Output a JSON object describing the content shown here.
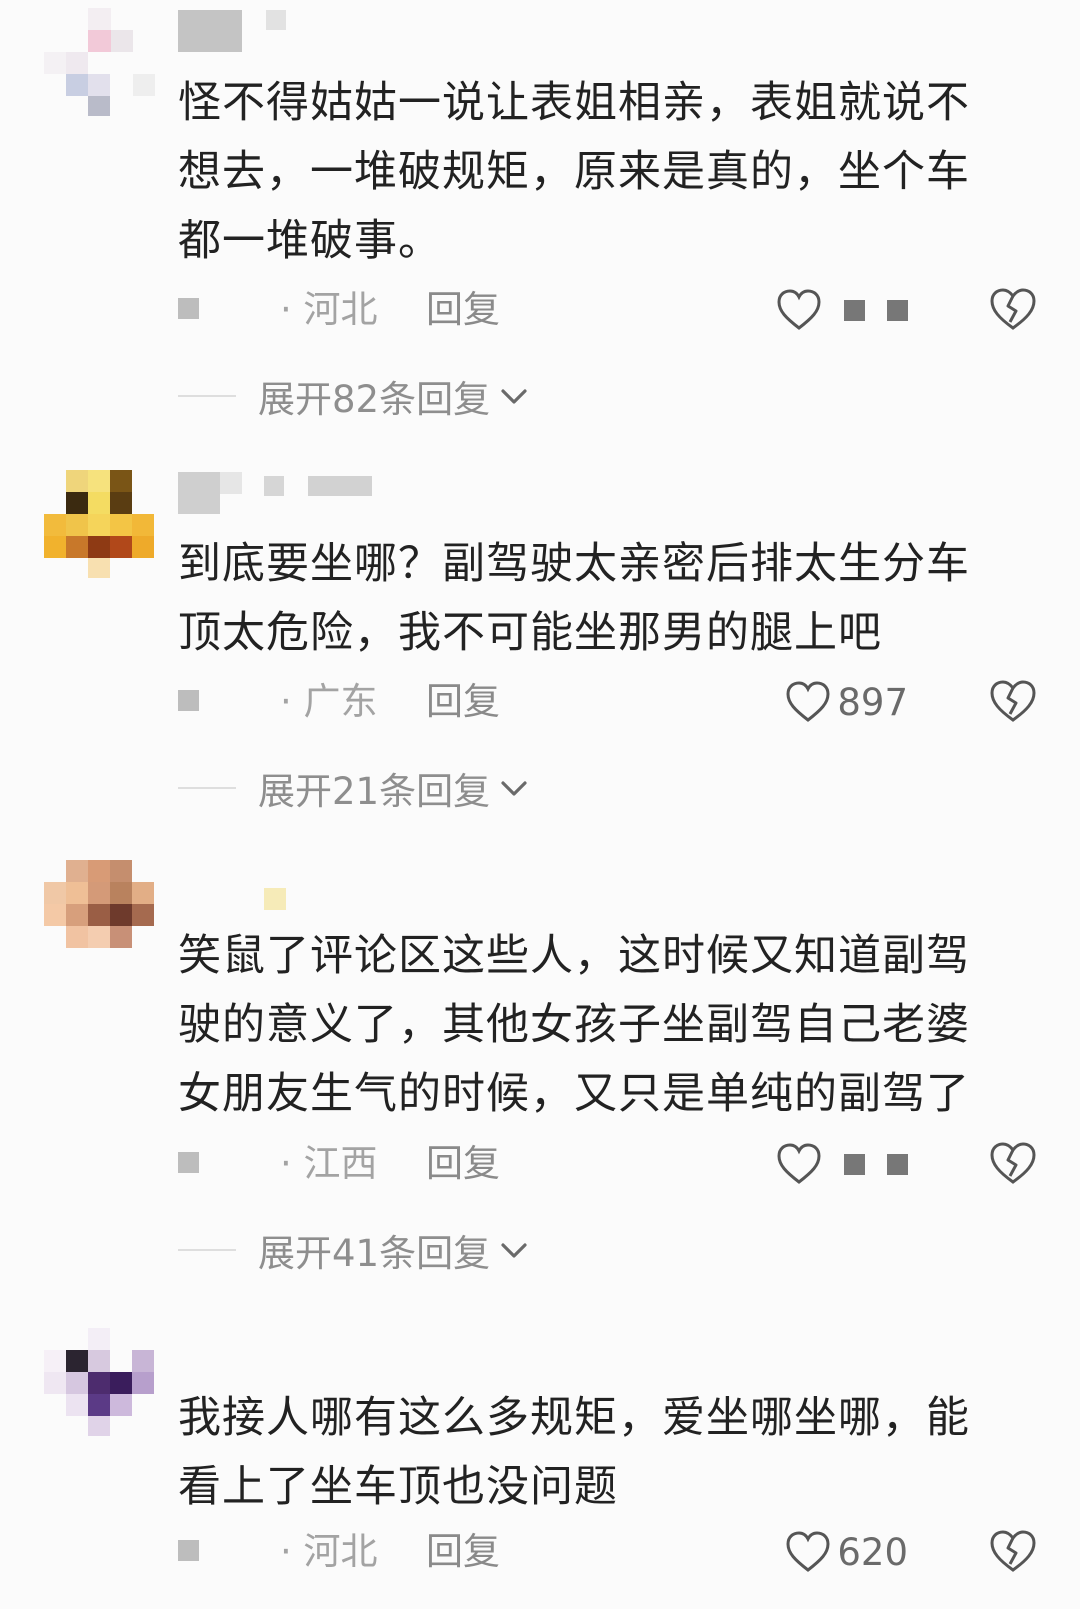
{
  "comments": [
    {
      "text": "怪不得姑姑一说让表姐相亲，表姐就说不想去，一堆破规矩，原来是真的，坐个车都一堆破事。",
      "location": "· 河北",
      "reply_label": "回复",
      "like_count": "",
      "like_icon": "heart-outline-icon",
      "dislike_icon": "broken-heart-icon",
      "expand_label": "展开82条回复"
    },
    {
      "text": "到底要坐哪？副驾驶太亲密后排太生分车顶太危险，我不可能坐那男的腿上吧",
      "location": "· 广东",
      "reply_label": "回复",
      "like_count": "897",
      "like_icon": "heart-outline-icon",
      "dislike_icon": "broken-heart-icon",
      "expand_label": "展开21条回复"
    },
    {
      "text": "笑鼠了评论区这些人，这时候又知道副驾驶的意义了，其他女孩子坐副驾自己老婆女朋友生气的时候，又只是单纯的副驾了",
      "location": "· 江西",
      "reply_label": "回复",
      "like_count": "",
      "like_icon": "heart-outline-icon",
      "dislike_icon": "broken-heart-icon",
      "expand_label": "展开41条回复"
    },
    {
      "text": "我接人哪有这么多规矩，爱坐哪坐哪，能看上了坐车顶也没问题",
      "location": "· 河北",
      "reply_label": "回复",
      "like_count": "620",
      "like_icon": "heart-outline-icon",
      "dislike_icon": "broken-heart-icon"
    }
  ],
  "colors": {
    "background": "#fbfbfb",
    "text": "#222222",
    "meta": "#a3a3a3",
    "icon": "#555555"
  }
}
